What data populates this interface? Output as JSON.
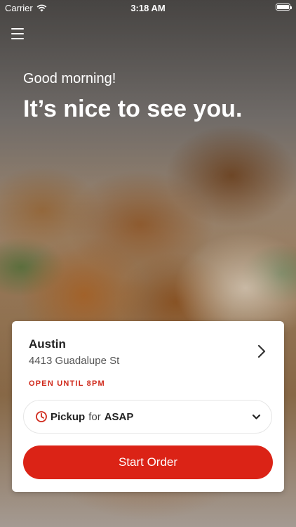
{
  "status_bar": {
    "carrier": "Carrier",
    "time": "3:18 AM"
  },
  "header": {
    "greeting": "Good morning!",
    "headline": "It’s nice to see you."
  },
  "location": {
    "name": "Austin",
    "address": "4413 Guadalupe St",
    "hours": "OPEN UNTIL 8PM"
  },
  "order_mode": {
    "mode": "Pickup",
    "connector": "for",
    "time": "ASAP"
  },
  "actions": {
    "start_order": "Start Order"
  },
  "colors": {
    "accent": "#db2316",
    "hours_text": "#d0291b"
  },
  "icons": {
    "menu": "hamburger-menu-icon",
    "chevron": "chevron-right-icon",
    "clock": "clock-icon",
    "dropdown": "chevron-down-icon",
    "wifi": "wifi-icon",
    "battery": "battery-icon"
  }
}
